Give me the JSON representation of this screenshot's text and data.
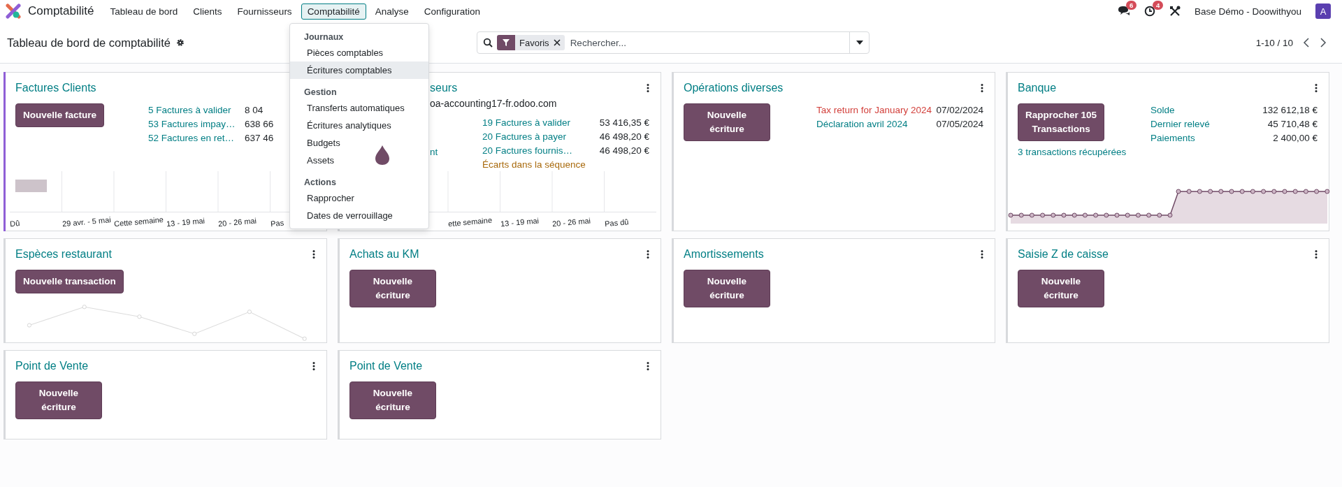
{
  "navbar": {
    "app_name": "Comptabilité",
    "menus": [
      {
        "label": "Tableau de bord",
        "selected": false
      },
      {
        "label": "Clients",
        "selected": false
      },
      {
        "label": "Fournisseurs",
        "selected": false
      },
      {
        "label": "Comptabilité",
        "selected": true
      },
      {
        "label": "Analyse",
        "selected": false
      },
      {
        "label": "Configuration",
        "selected": false
      }
    ],
    "messages_badge": "6",
    "activities_badge": "4",
    "company": "Base Démo - Doowithyou",
    "avatar": "A"
  },
  "control_panel": {
    "title": "Tableau de bord de comptabilité",
    "facet": "Favoris",
    "search_placeholder": "Rechercher...",
    "pager": "1-10 / 10"
  },
  "menu_dropdown": {
    "sections": [
      {
        "header": "Journaux",
        "items": [
          {
            "label": "Pièces comptables",
            "selected": false
          },
          {
            "label": "Écritures comptables",
            "selected": true
          }
        ]
      },
      {
        "header": "Gestion",
        "items": [
          {
            "label": "Transferts automatiques",
            "selected": false
          },
          {
            "label": "Écritures analytiques",
            "selected": false
          },
          {
            "label": "Budgets",
            "selected": false
          },
          {
            "label": "Assets",
            "selected": false
          }
        ]
      },
      {
        "header": "Actions",
        "items": [
          {
            "label": "Rapprocher",
            "selected": false
          },
          {
            "label": "Dates de verrouillage",
            "selected": false
          }
        ]
      }
    ]
  },
  "cards": [
    {
      "title": "Factures Clients",
      "kind": "bar",
      "highlighted": true,
      "covered_right": true,
      "menu": false,
      "button": "Nouvelle facture",
      "rows": [
        {
          "label": "5 Factures à valider",
          "amount": "8 04",
          "color": "#017e84"
        },
        {
          "label": "53 Factures impay…",
          "amount": "638 66",
          "color": "#017e84"
        },
        {
          "label": "52 Factures en ret…",
          "amount": "637 46",
          "color": "#017e84"
        }
      ],
      "axis_labels": [
        "Dû",
        "29 avr. - 5 mai",
        "Cette semaine",
        "13 - 19 mai",
        "20 - 26 mai",
        "Pas"
      ]
    },
    {
      "title": "seurs",
      "kind": "bar",
      "subtitle": "oa-accounting17-fr.odoo.com",
      "highlighted": false,
      "covered_left": true,
      "menu": true,
      "side_text": "nt",
      "rows": [
        {
          "label": "19 Factures à valider",
          "amount": "53 416,35 €",
          "color": "#017e84"
        },
        {
          "label": "20 Factures à payer",
          "amount": "46 498,20 €",
          "color": "#017e84"
        },
        {
          "label": "20 Factures fournis…",
          "amount": "46 498,20 €",
          "color": "#017e84"
        },
        {
          "label": "Écarts dans la séquence",
          "color": "#a8690b"
        }
      ],
      "axis_labels": [
        "ette semaine",
        "13 - 19 mai",
        "20 - 26 mai",
        "Pas dû"
      ]
    },
    {
      "title": "Opérations diverses",
      "kind": "plain",
      "highlighted": false,
      "menu": true,
      "button": "Nouvelle\nécriture",
      "rows": [
        {
          "label": "Tax return for January 2024",
          "amount": "07/02/2024",
          "color": "#d23f3a"
        },
        {
          "label": "Déclaration avril 2024",
          "amount": "07/05/2024",
          "color": "#017e84"
        }
      ]
    },
    {
      "title": "Banque",
      "kind": "bank",
      "highlighted": false,
      "menu": true,
      "button": "Rapprocher 105\nTransactions",
      "footer_link": "3 transactions récupérées",
      "rows": [
        {
          "label": "Solde",
          "amount": "132 612,18 €",
          "color": "#017e84"
        },
        {
          "label": "Dernier relevé",
          "amount": "45 710,48 €",
          "color": "#017e84"
        },
        {
          "label": "Paiements",
          "amount": "2 400,00 €",
          "color": "#017e84"
        }
      ]
    },
    {
      "title": "Espèces restaurant",
      "kind": "line",
      "highlighted": false,
      "menu": true,
      "button": "Nouvelle transaction"
    },
    {
      "title": "Achats au KM",
      "kind": "plain",
      "highlighted": false,
      "menu": true,
      "button": "Nouvelle\nécriture"
    },
    {
      "title": "Amortissements",
      "kind": "plain",
      "highlighted": false,
      "menu": true,
      "button": "Nouvelle\nécriture"
    },
    {
      "title": "Saisie Z de caisse",
      "kind": "plain",
      "highlighted": false,
      "menu": true,
      "button": "Nouvelle\nécriture"
    },
    {
      "title": "Point de Vente",
      "kind": "plain",
      "highlighted": false,
      "menu": true,
      "button": "Nouvelle\nécriture"
    },
    {
      "title": "Point de Vente",
      "kind": "plain",
      "highlighted": false,
      "menu": true,
      "button": "Nouvelle\nécriture"
    }
  ]
}
